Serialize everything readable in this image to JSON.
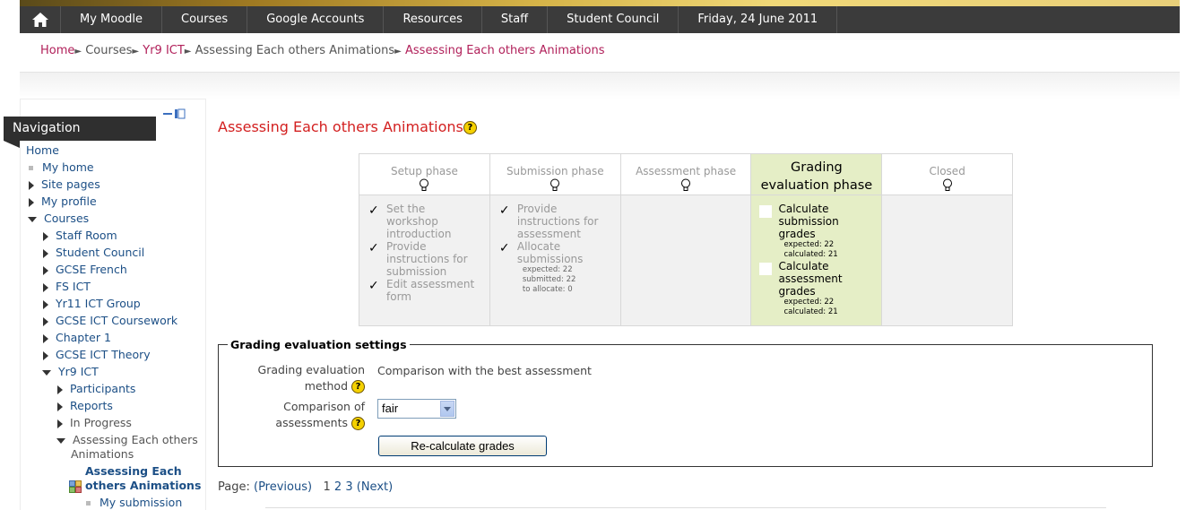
{
  "topnav": {
    "home_icon": "home-icon",
    "items": [
      "My Moodle",
      "Courses",
      "Google Accounts",
      "Resources",
      "Staff",
      "Student Council",
      "Friday, 24 June 2011"
    ]
  },
  "breadcrumb": {
    "items": [
      "Home",
      "Courses",
      "Yr9 ICT",
      "Assessing Each others Animations",
      "Assessing Each others Animations"
    ],
    "separator": "►"
  },
  "sidebar": {
    "title": "Navigation",
    "home": "Home",
    "items": [
      "My home",
      "Site pages",
      "My profile",
      "Courses",
      "Staff Room",
      "Student Council",
      "GCSE French",
      "FS ICT",
      "Yr11 ICT Group",
      "GCSE ICT Coursework",
      "Chapter 1",
      "GCSE ICT Theory",
      "Yr9 ICT",
      "Participants",
      "Reports",
      "In Progress",
      "Assessing Each others",
      "Animations",
      "Assessing Each",
      "others Animations",
      "My submission"
    ]
  },
  "main": {
    "title": "Assessing Each others Animations",
    "help_icon": "?",
    "phases": {
      "setup": {
        "name": "Setup phase",
        "tasks": [
          "Set the",
          "workshop",
          "introduction",
          "Provide",
          "instructions for",
          "submission",
          "Edit assessment",
          "form"
        ]
      },
      "submission": {
        "name": "Submission phase",
        "tasks": [
          "Provide",
          "instructions for",
          "assessment",
          "Allocate",
          "submissions"
        ],
        "details": [
          "expected: 22",
          "submitted: 22",
          "to allocate: 0"
        ]
      },
      "assessment": {
        "name": "Assessment phase"
      },
      "grading": {
        "name_line1": "Grading",
        "name_line2": "evaluation phase",
        "tasks": [
          "Calculate",
          "submission",
          "grades",
          "Calculate",
          "assessment",
          "grades"
        ],
        "details": [
          "expected: 22",
          "calculated: 21",
          "expected: 22",
          "calculated: 21"
        ]
      },
      "closed": {
        "name": "Closed"
      },
      "check_mark": "✓"
    },
    "settings": {
      "legend": "Grading evaluation settings",
      "method_label_1": "Grading evaluation",
      "method_label_2": "method",
      "method_value": "Comparison with the best assessment",
      "comparison_label_1": "Comparison of",
      "comparison_label_2": "assessments",
      "comparison_value": "fair",
      "recalc_button": "Re-calculate grades"
    },
    "paging": {
      "label": "Page:",
      "previous": "(Previous)",
      "pages": [
        "1",
        "2",
        "3"
      ],
      "next": "(Next)"
    }
  }
}
